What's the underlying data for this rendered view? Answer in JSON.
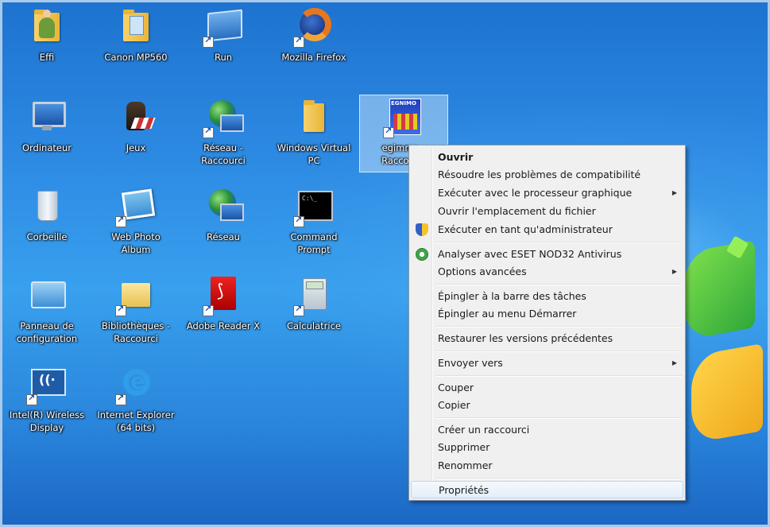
{
  "desktop": {
    "icons": [
      {
        "label": "Effi",
        "icon": "user-folder-icon"
      },
      {
        "label": "Canon MP560",
        "icon": "printer-folder-icon"
      },
      {
        "label": "Run",
        "icon": "run-icon"
      },
      {
        "label": "Mozilla Firefox",
        "icon": "firefox-icon"
      },
      {
        "label": "Ordinateur",
        "icon": "computer-icon"
      },
      {
        "label": "Jeux",
        "icon": "games-icon"
      },
      {
        "label": "Réseau - Raccourci",
        "icon": "network-icon"
      },
      {
        "label": "Windows Virtual PC",
        "icon": "folder-icon"
      },
      {
        "label": "egimmo - Raccourci",
        "icon": "egimmo-icon",
        "selected": true
      },
      {
        "label": "Corbeille",
        "icon": "recycle-bin-icon"
      },
      {
        "label": "Web Photo Album",
        "icon": "photo-album-icon"
      },
      {
        "label": "Réseau",
        "icon": "network-icon"
      },
      {
        "label": "Command Prompt",
        "icon": "command-prompt-icon"
      },
      {
        "label": "Panneau de configuration",
        "icon": "control-panel-icon"
      },
      {
        "label": "Bibliothèques - Raccourci",
        "icon": "library-folder-icon"
      },
      {
        "label": "Adobe Reader X",
        "icon": "pdf-icon"
      },
      {
        "label": "Calculatrice",
        "icon": "calculator-icon"
      },
      {
        "label": "Intel(R) Wireless Display",
        "icon": "wireless-display-icon"
      },
      {
        "label": "Internet Explorer (64 bits)",
        "icon": "internet-explorer-icon"
      }
    ]
  },
  "context_menu": {
    "items": [
      {
        "label": "Ouvrir",
        "bold": true
      },
      {
        "label": "Résoudre les problèmes de compatibilité"
      },
      {
        "label": "Exécuter avec le processeur graphique",
        "submenu": true
      },
      {
        "label": "Ouvrir l'emplacement du fichier"
      },
      {
        "label": "Exécuter en tant qu'administrateur",
        "icon": "uac-shield-icon"
      },
      {
        "label": "Analyser avec ESET NOD32 Antivirus",
        "icon": "eset-icon"
      },
      {
        "label": "Options avancées",
        "submenu": true
      },
      {
        "label": "Épingler à la barre des tâches"
      },
      {
        "label": "Épingler au menu Démarrer"
      },
      {
        "label": "Restaurer les versions précédentes"
      },
      {
        "label": "Envoyer vers",
        "submenu": true
      },
      {
        "label": "Couper"
      },
      {
        "label": "Copier"
      },
      {
        "label": "Créer un raccourci"
      },
      {
        "label": "Supprimer"
      },
      {
        "label": "Renommer"
      },
      {
        "label": "Propriétés",
        "highlighted": true
      }
    ],
    "submenu_arrow": "▶"
  }
}
